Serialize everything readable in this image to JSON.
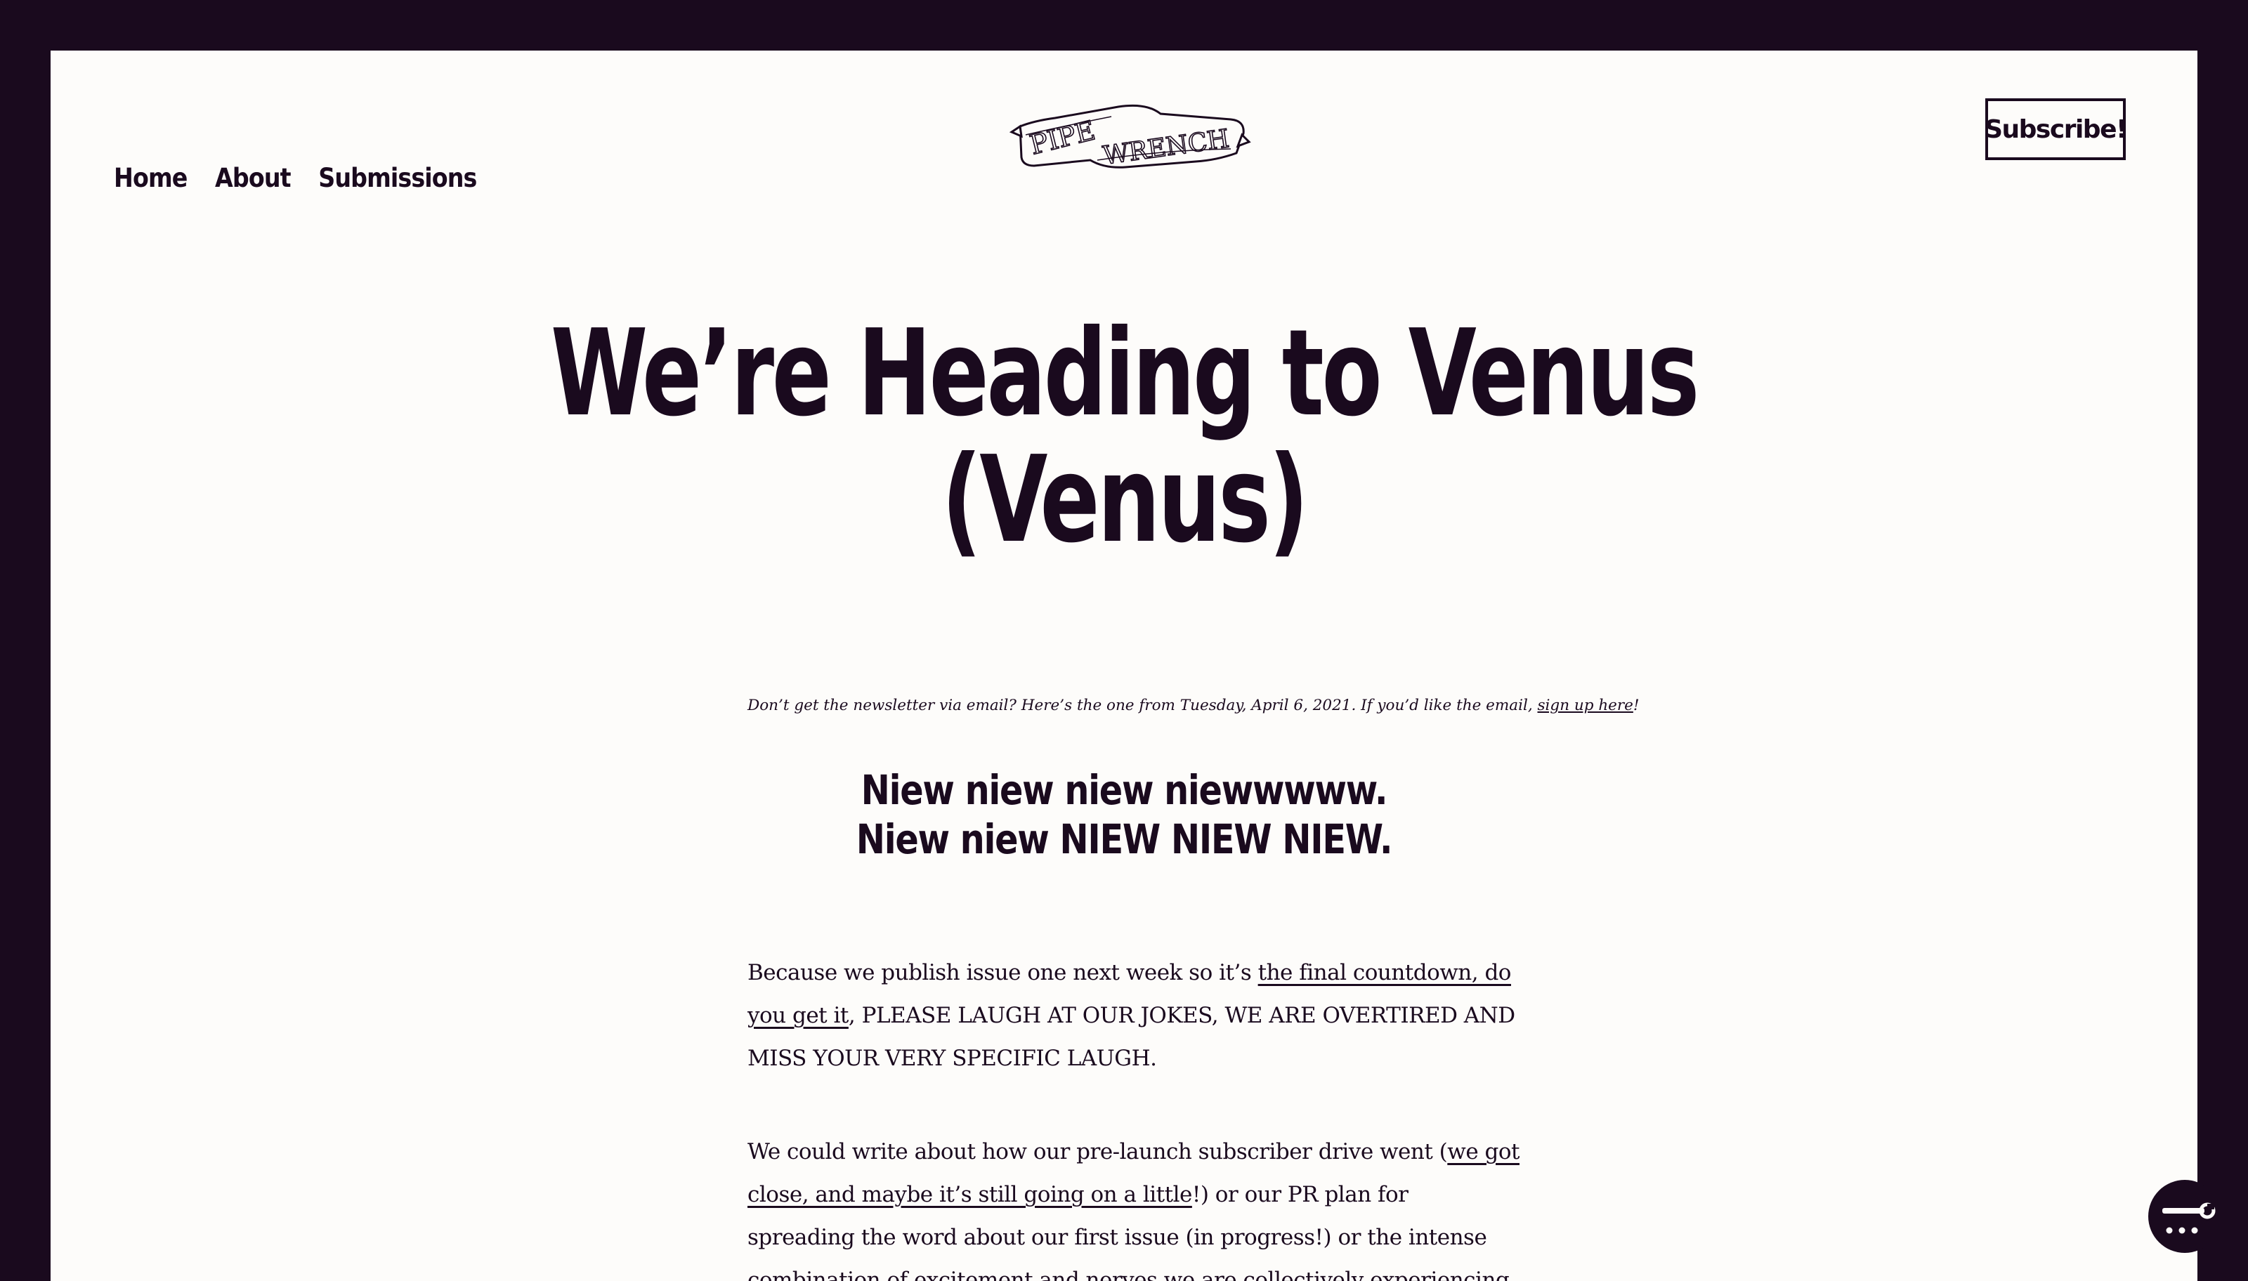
{
  "nav": {
    "items": [
      {
        "label": "Home"
      },
      {
        "label": "About"
      },
      {
        "label": "Submissions"
      }
    ]
  },
  "logo": {
    "text_left": "PIPE",
    "text_right": "WRENCH"
  },
  "header": {
    "subscribe_label": "Subscribe!"
  },
  "article": {
    "title_line1": "We’re Heading to Venus",
    "title_line2": "(Venus)",
    "intro": {
      "text": "Don’t get the newsletter via email? Here’s the one from Tuesday, April 6, 2021. If you’d like the email, ",
      "link": "sign up here",
      "suffix": "!"
    },
    "subhead_line1": "Niew niew niew niewwwww.",
    "subhead_line2": "Niew niew NIEW NIEW NIEW.",
    "p1": {
      "before": "Because we publish issue one next week so it’s ",
      "link": "the final countdown, do you get it",
      "after": ", PLEASE LAUGH AT OUR JOKES, WE ARE OVERTIRED AND MISS YOUR VERY SPECIFIC LAUGH."
    },
    "p2": {
      "before": "We could write about how our pre-launch subscriber drive went (",
      "link": "we got close, and maybe it’s still going on a little",
      "after": "!) or our PR plan for spreading the word about our first issue (in progress!) or the intense combination of excitement and nerves we are collectively experiencing (whoa!) or"
    }
  },
  "colors": {
    "frame": "#1a0a1e",
    "page": "#fdfcfa",
    "text": "#1a0a1e"
  },
  "widget": {
    "icon": "wrench-chat-icon"
  }
}
